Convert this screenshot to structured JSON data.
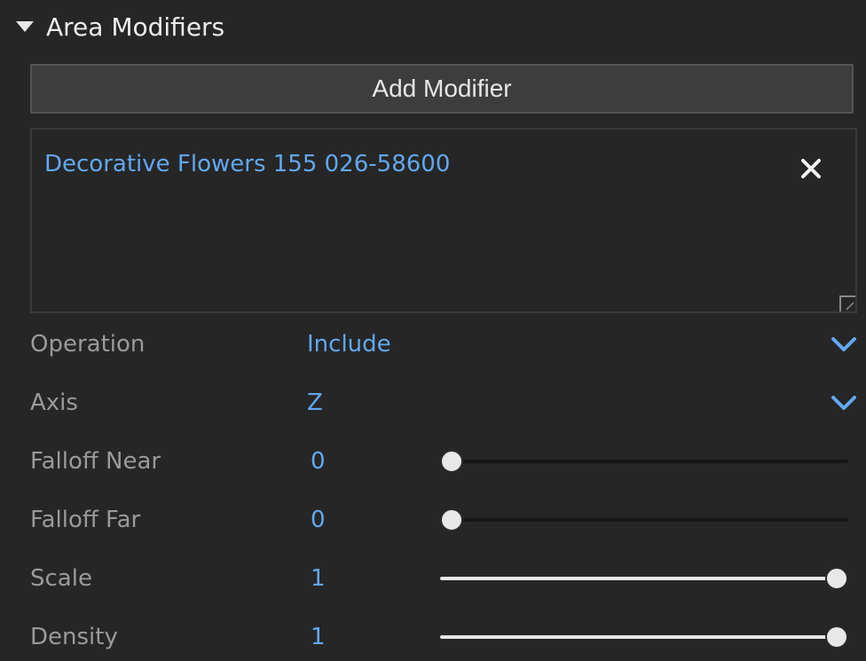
{
  "section": {
    "title": "Area Modifiers"
  },
  "add_button": {
    "label": "Add Modifier"
  },
  "modifiers": [
    {
      "name": "Decorative Flowers 155 026-58600"
    }
  ],
  "properties": {
    "operation": {
      "label": "Operation",
      "value": "Include"
    },
    "axis": {
      "label": "Axis",
      "value": "Z"
    },
    "falloff_near": {
      "label": "Falloff Near",
      "value": "0",
      "fraction": 0
    },
    "falloff_far": {
      "label": "Falloff Far",
      "value": "0",
      "fraction": 0
    },
    "scale": {
      "label": "Scale",
      "value": "1",
      "fraction": 1
    },
    "density": {
      "label": "Density",
      "value": "1",
      "fraction": 1
    }
  },
  "colors": {
    "background": "#262626",
    "accent": "#62a8f0",
    "label": "#9a9a9a",
    "text": "#ececec"
  },
  "icons": {
    "collapse": "triangle-down-icon",
    "remove": "close-icon",
    "dropdown": "chevron-down-icon",
    "resize": "resize-handle-icon"
  }
}
